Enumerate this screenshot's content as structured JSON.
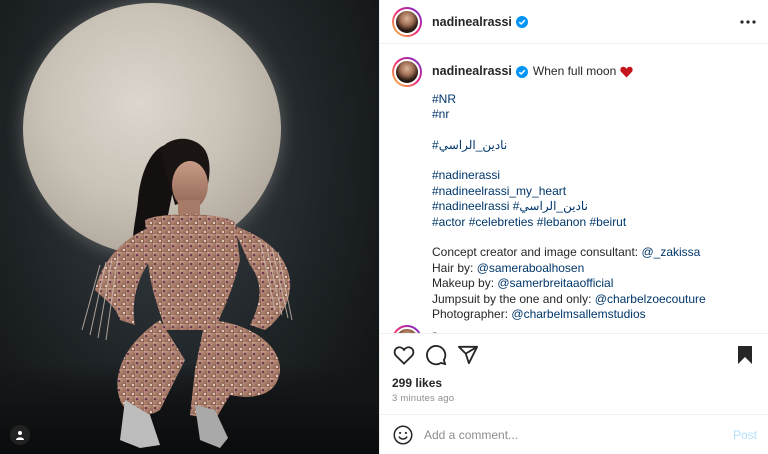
{
  "post": {
    "username": "nadinealrassi",
    "caption": "When full moon",
    "caption_lines": [
      "#NR",
      "#nr",
      "",
      "#نادين_الراسي",
      "",
      "#nadinerassi",
      "#nadineelrassi_my_heart",
      "#nadineelrassi #نادين_الراسي",
      "#actor #celebreties #lebanon #beirut",
      "",
      "Concept creator and image consultant: @_zakissa",
      "Hair by: @sameraboalhosen",
      "Makeup by: @samerbreitaaofficial",
      "Jumpsuit by the one and only: @charbelzoecouture",
      "Photographer: @charbelmsallemstudios"
    ],
    "caption_time": "3m",
    "likes": "299 likes",
    "time_ago": "3 minutes ago"
  },
  "comment_box": {
    "placeholder": "Add a comment...",
    "post_label": "Post"
  },
  "icons": {
    "verified": "verified-badge-icon",
    "more": "more-options-icon",
    "like": "heart-icon",
    "comment": "comment-icon",
    "share": "share-icon",
    "save": "bookmark-icon",
    "emoji": "emoji-icon",
    "tagged": "user-tag-icon"
  },
  "colors": {
    "link": "#00376b",
    "verified": "#0095f6",
    "heart_emoji": "#c4161c",
    "post_disabled": "#b2dffc"
  }
}
